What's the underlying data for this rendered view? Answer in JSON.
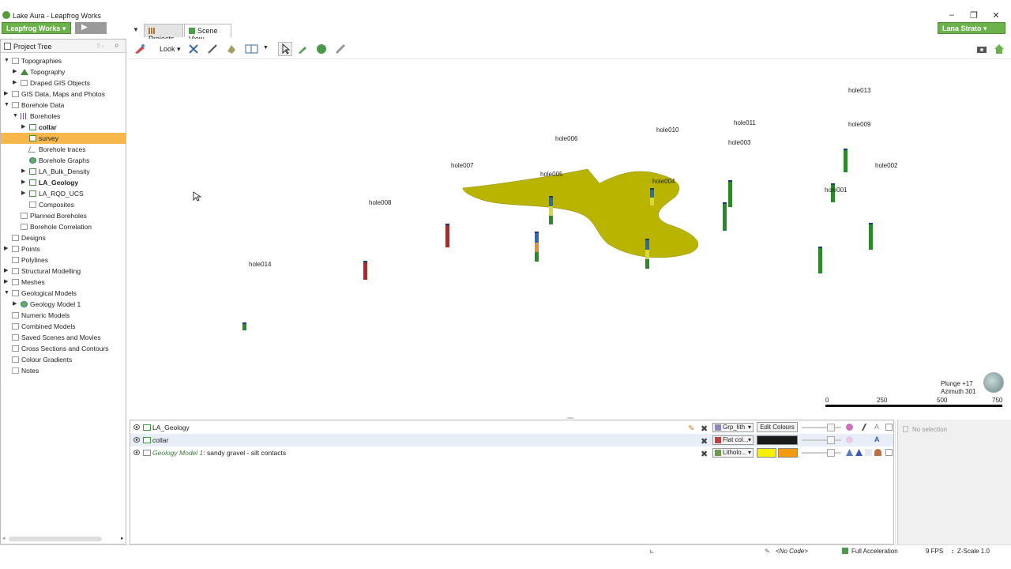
{
  "window": {
    "title": "Lake Aura - Leapfrog Works",
    "controls": [
      "minimize-icon",
      "restore-icon",
      "close-icon"
    ]
  },
  "brand": {
    "label": "Leapfrog Works ▾",
    "play_label": "▶"
  },
  "user": {
    "label": "Lana Strato ▾"
  },
  "tabs": [
    {
      "label": "Projects",
      "icon": "projects-icon"
    },
    {
      "label": "Scene View",
      "icon": "scene-cube-icon"
    }
  ],
  "project_tree": {
    "header": "Project Tree",
    "items": [
      {
        "label": "Topographies",
        "level": 0,
        "expander": "expanded",
        "icon": "folder"
      },
      {
        "label": "Topography",
        "level": 1,
        "expander": "collapsed",
        "icon": "tri"
      },
      {
        "label": "Draped GIS Objects",
        "level": 1,
        "expander": "collapsed",
        "icon": "folder"
      },
      {
        "label": "GIS Data, Maps and Photos",
        "level": 0,
        "expander": "collapsed",
        "icon": "folder"
      },
      {
        "label": "Borehole Data",
        "level": 0,
        "expander": "expanded",
        "icon": "folder"
      },
      {
        "label": "Boreholes",
        "level": 1,
        "expander": "expanded",
        "icon": "bh"
      },
      {
        "label": "collar",
        "level": 2,
        "expander": "collapsed",
        "icon": "green",
        "bold": true
      },
      {
        "label": "survey",
        "level": 2,
        "expander": "",
        "icon": "green",
        "selected": true
      },
      {
        "label": "Borehole traces",
        "level": 2,
        "expander": "",
        "icon": "trace"
      },
      {
        "label": "Borehole Graphs",
        "level": 2,
        "expander": "",
        "icon": "globe"
      },
      {
        "label": "LA_Bulk_Density",
        "level": 2,
        "expander": "collapsed",
        "icon": "green"
      },
      {
        "label": "LA_Geology",
        "level": 2,
        "expander": "collapsed",
        "icon": "green",
        "bold": true
      },
      {
        "label": "LA_RQD_UCS",
        "level": 2,
        "expander": "collapsed",
        "icon": "green"
      },
      {
        "label": "Composites",
        "level": 2,
        "expander": "",
        "icon": "folder"
      },
      {
        "label": "Planned Boreholes",
        "level": 1,
        "expander": "",
        "icon": "folder"
      },
      {
        "label": "Borehole Correlation",
        "level": 1,
        "expander": "",
        "icon": "folder"
      },
      {
        "label": "Designs",
        "level": 0,
        "expander": "",
        "icon": "folder"
      },
      {
        "label": "Points",
        "level": 0,
        "expander": "collapsed",
        "icon": "folder"
      },
      {
        "label": "Polylines",
        "level": 0,
        "expander": "",
        "icon": "folder"
      },
      {
        "label": "Structural Modelling",
        "level": 0,
        "expander": "collapsed",
        "icon": "folder"
      },
      {
        "label": "Meshes",
        "level": 0,
        "expander": "collapsed",
        "icon": "folder"
      },
      {
        "label": "Geological Models",
        "level": 0,
        "expander": "expanded",
        "icon": "folder"
      },
      {
        "label": "Geology Model 1",
        "level": 1,
        "expander": "collapsed",
        "icon": "globe"
      },
      {
        "label": "Numeric Models",
        "level": 0,
        "expander": "",
        "icon": "folder"
      },
      {
        "label": "Combined Models",
        "level": 0,
        "expander": "",
        "icon": "folder"
      },
      {
        "label": "Saved Scenes and Movies",
        "level": 0,
        "expander": "",
        "icon": "folder"
      },
      {
        "label": "Cross Sections and Contours",
        "level": 0,
        "expander": "",
        "icon": "folder"
      },
      {
        "label": "Colour Gradients",
        "level": 0,
        "expander": "",
        "icon": "folder"
      },
      {
        "label": "Notes",
        "level": 0,
        "expander": "",
        "icon": "note"
      }
    ]
  },
  "toolbar": {
    "look_label": "Look ▾"
  },
  "scene": {
    "holes": [
      {
        "label": "hole013",
        "colors": [
          "#2a8a2a"
        ]
      },
      {
        "label": "hole011",
        "colors": [
          "#2a8a2a"
        ]
      },
      {
        "label": "hole009",
        "colors": [
          "#2a8a2a"
        ]
      },
      {
        "label": "hole010",
        "colors": [
          "#2a6ab0",
          "#d8d840"
        ]
      },
      {
        "label": "hole006",
        "colors": [
          "#2a6ab0",
          "#d8d840",
          "#2a8a2a"
        ]
      },
      {
        "label": "hole003",
        "colors": [
          "#2a8a2a"
        ]
      },
      {
        "label": "hole007",
        "colors": [
          "#a03030"
        ]
      },
      {
        "label": "hole002",
        "colors": [
          "#2a8a2a"
        ]
      },
      {
        "label": "hole005",
        "colors": [
          "#2a6ab0",
          "#d89030",
          "#2a8a2a"
        ]
      },
      {
        "label": "hole004",
        "colors": [
          "#2a6ab0",
          "#d8d840",
          "#2a8a2a"
        ]
      },
      {
        "label": "hole001",
        "colors": [
          "#2a8a2a"
        ]
      },
      {
        "label": "hole008",
        "colors": [
          "#a03030"
        ]
      },
      {
        "label": "hole014",
        "colors": [
          "#2a8a2a"
        ]
      }
    ],
    "surface_color": "#b8b400",
    "plunge": "Plunge +17",
    "azimuth": "Azimuth 301",
    "scale_labels": [
      "0",
      "250",
      "500",
      "750"
    ]
  },
  "shape_list": {
    "rows": [
      {
        "label": "LA_Geology",
        "prefix": "",
        "dropdown": "Grp_lith",
        "button": "Edit Colours",
        "swatches": []
      },
      {
        "label": "collar",
        "prefix": "",
        "dropdown": "Flat col...",
        "button": "",
        "swatches": [
          "#1a1a1a"
        ]
      },
      {
        "label": ": sandy gravel - silt contacts",
        "prefix": "Geology Model 1",
        "dropdown": "Litholo...",
        "button": "",
        "swatches": [
          "#f4f000",
          "#f49a10"
        ]
      }
    ]
  },
  "properties": {
    "no_selection": "No selection"
  },
  "status": {
    "code": "<No Code>",
    "acceleration": "Full Acceleration",
    "fps": "9 FPS",
    "zscale": "Z-Scale 1.0"
  }
}
